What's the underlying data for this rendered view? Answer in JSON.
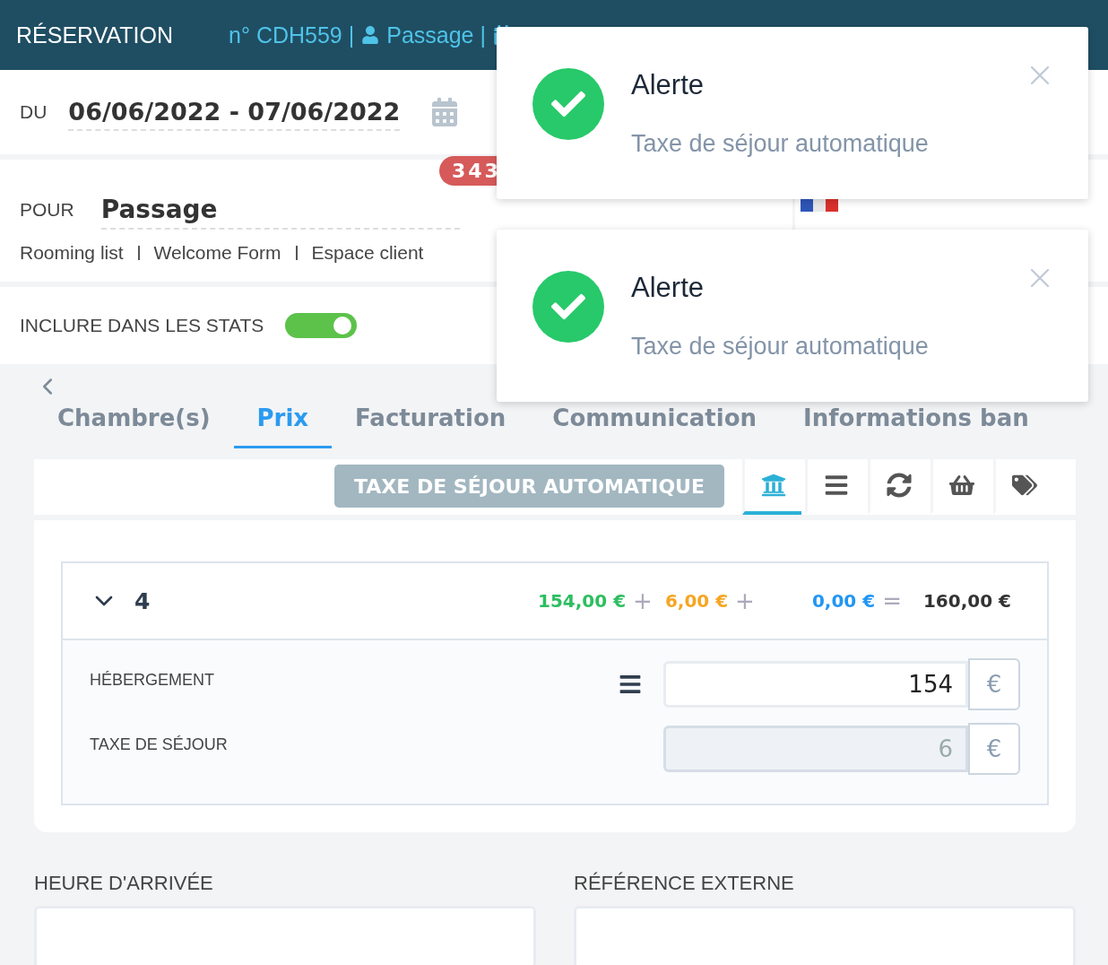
{
  "header": {
    "title": "RÉSERVATION",
    "booking": "n° CDH559 |",
    "guest": "Passage |"
  },
  "dates": {
    "label": "DU",
    "value": "06/06/2022 - 07/06/2022"
  },
  "client": {
    "label": "POUR",
    "value": "Passage",
    "badge": "343"
  },
  "links": [
    "Rooming list",
    "Welcome Form",
    "Espace client"
  ],
  "stats": {
    "label": "INCLURE DANS LES STATS",
    "on": true
  },
  "tabs": [
    {
      "label": "Chambre(s)",
      "selected": false
    },
    {
      "label": "Prix",
      "selected": true
    },
    {
      "label": "Facturation",
      "selected": false
    },
    {
      "label": "Communication",
      "selected": false
    },
    {
      "label": "Informations ban",
      "selected": false
    }
  ],
  "toolbar": {
    "button": "TAXE DE SÉJOUR AUTOMATIQUE",
    "tools": [
      {
        "kind": "bank",
        "selected": true
      },
      {
        "kind": "list",
        "selected": false
      },
      {
        "kind": "refresh",
        "selected": false
      },
      {
        "kind": "basket",
        "selected": false
      },
      {
        "kind": "tags",
        "selected": false
      }
    ]
  },
  "room": {
    "number": "4",
    "expanded": true,
    "amounts": [
      {
        "value": "154,00 €",
        "operator": "+",
        "color": "#2dbe60"
      },
      {
        "value": "6,00 €",
        "operator": "+",
        "color": "#f5a623"
      },
      {
        "value": "0,00 €",
        "operator": "=",
        "color": "#2196f3"
      }
    ],
    "total": "160,00 €",
    "lines": [
      {
        "label": "HÉBERGEMENT",
        "value": "154",
        "unit": "€",
        "disabled": false,
        "menu": true
      },
      {
        "label": "TAXE DE SÉJOUR",
        "value": "6",
        "unit": "€",
        "disabled": true,
        "menu": false
      }
    ]
  },
  "fields": [
    {
      "label": "HEURE D'ARRIVÉE"
    },
    {
      "label": "RÉFÉRENCE EXTERNE"
    }
  ],
  "toasts": [
    {
      "title": "Alerte",
      "message": "Taxe de séjour automatique"
    },
    {
      "title": "Alerte",
      "message": "Taxe de séjour automatique"
    }
  ]
}
